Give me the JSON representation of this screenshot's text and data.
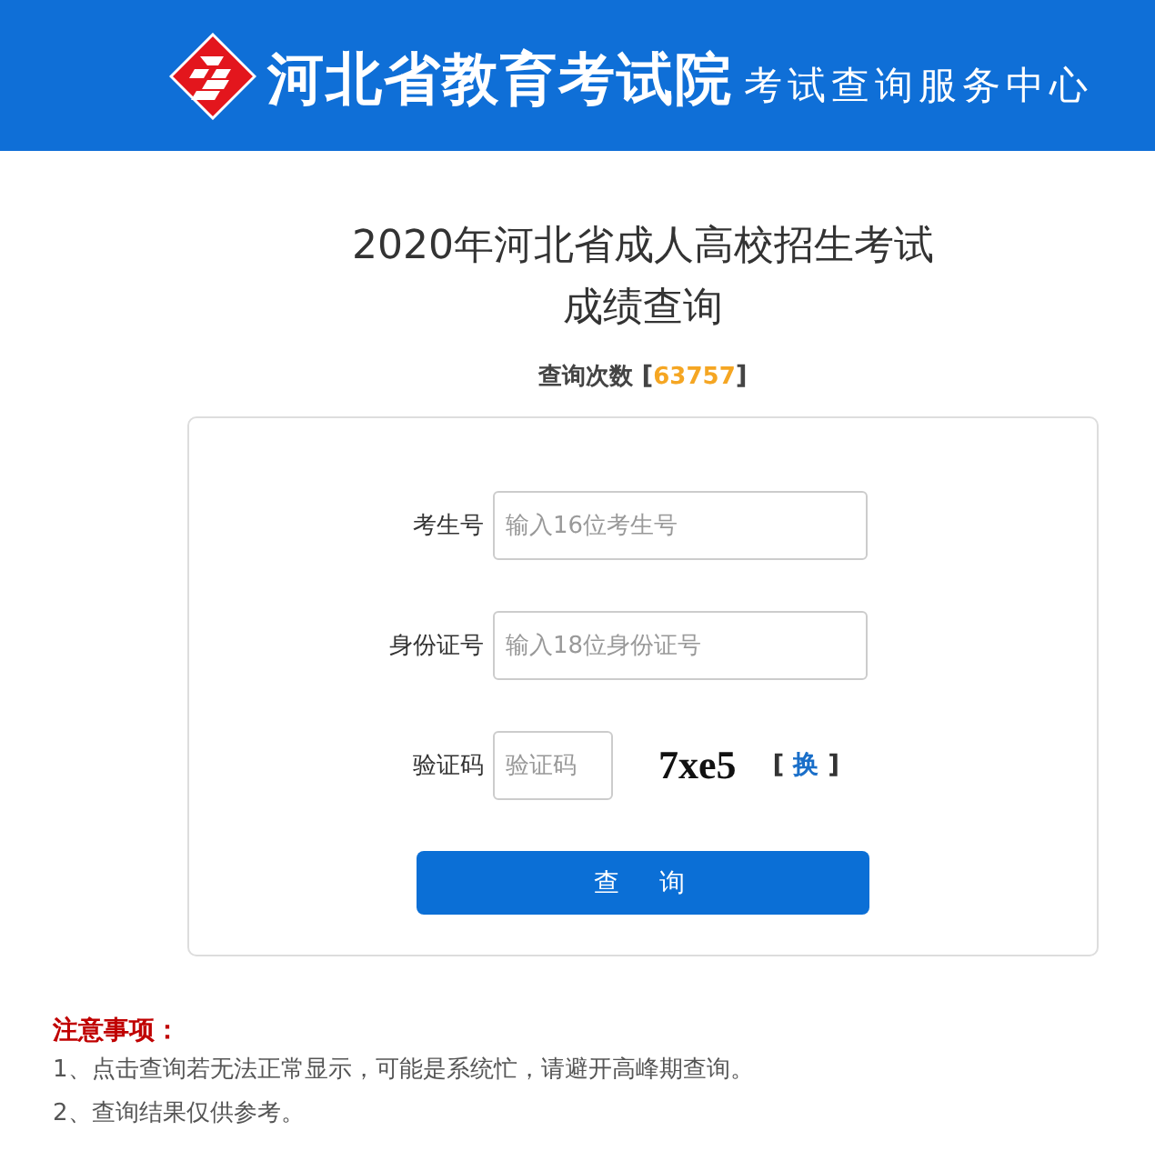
{
  "header": {
    "title": "河北省教育考试院",
    "subtitle": "考试查询服务中心"
  },
  "title_lines": [
    "2020年河北省成人高校招生考试",
    "成绩查询"
  ],
  "counter": {
    "label": "查询次数",
    "prefix": "[",
    "value": "63757",
    "suffix": "]"
  },
  "form": {
    "fields": [
      {
        "kind": "text",
        "label": "考生号",
        "placeholder": "输入16位考生号"
      },
      {
        "kind": "text",
        "label": "身份证号",
        "placeholder": "输入18位身份证号"
      },
      {
        "kind": "captcha",
        "label": "验证码",
        "placeholder": "验证码",
        "captcha_text": "7xe5",
        "refresh": {
          "prefix": "[",
          "label": "换",
          "suffix": "]"
        }
      }
    ],
    "submit": "查　询"
  },
  "notice": {
    "title": "注意事项：",
    "items": [
      "1、点击查询若无法正常显示，可能是系统忙，请避开高峰期查询。",
      "2、查询结果仅供参考。"
    ]
  }
}
